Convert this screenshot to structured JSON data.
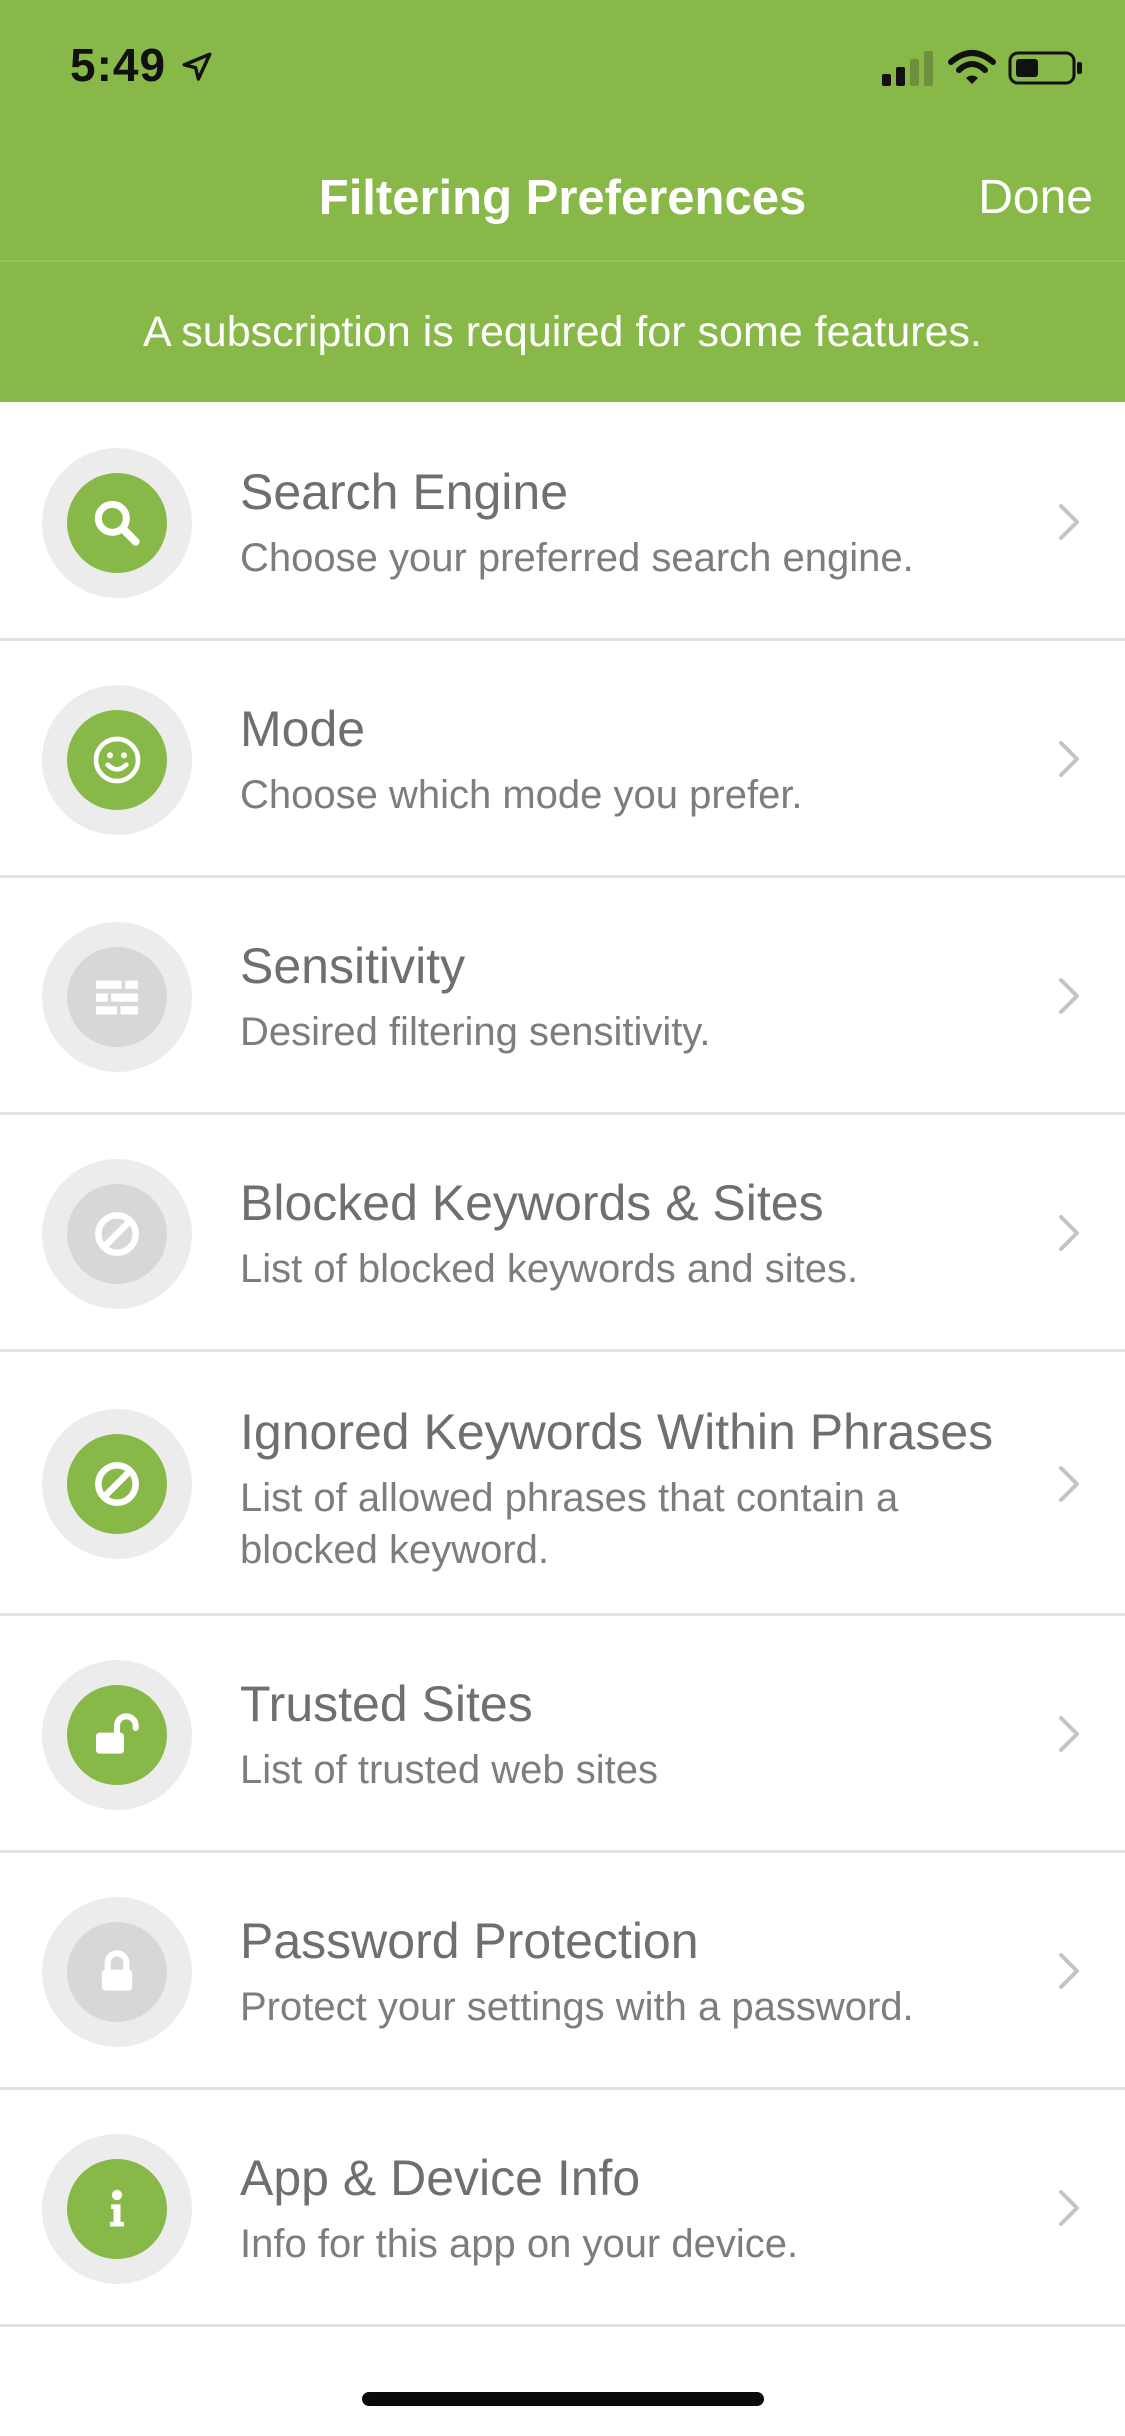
{
  "status_bar": {
    "time": "5:49"
  },
  "nav": {
    "title": "Filtering Preferences",
    "done_label": "Done"
  },
  "banner": {
    "text": "A subscription is required for some features."
  },
  "colors": {
    "brand_green": "#88b847",
    "disabled_gray": "#d6d7d9"
  },
  "items": [
    {
      "title": "Search Engine",
      "subtitle": "Choose your preferred search engine.",
      "icon": "search-icon",
      "enabled": true
    },
    {
      "title": "Mode",
      "subtitle": "Choose which mode you prefer.",
      "icon": "smiley-icon",
      "enabled": true
    },
    {
      "title": "Sensitivity",
      "subtitle": "Desired filtering sensitivity.",
      "icon": "sliders-icon",
      "enabled": false
    },
    {
      "title": "Blocked Keywords & Sites",
      "subtitle": "List of blocked keywords and sites.",
      "icon": "block-icon",
      "enabled": false
    },
    {
      "title": "Ignored Keywords Within Phrases",
      "subtitle": "List of allowed phrases that contain a blocked keyword.",
      "icon": "block-icon",
      "enabled": true
    },
    {
      "title": "Trusted Sites",
      "subtitle": "List of trusted web sites",
      "icon": "unlock-icon",
      "enabled": true
    },
    {
      "title": "Password Protection",
      "subtitle": "Protect your settings with a password.",
      "icon": "lock-icon",
      "enabled": false
    },
    {
      "title": "App & Device Info",
      "subtitle": "Info for this app on your device.",
      "icon": "info-icon",
      "enabled": true
    }
  ]
}
